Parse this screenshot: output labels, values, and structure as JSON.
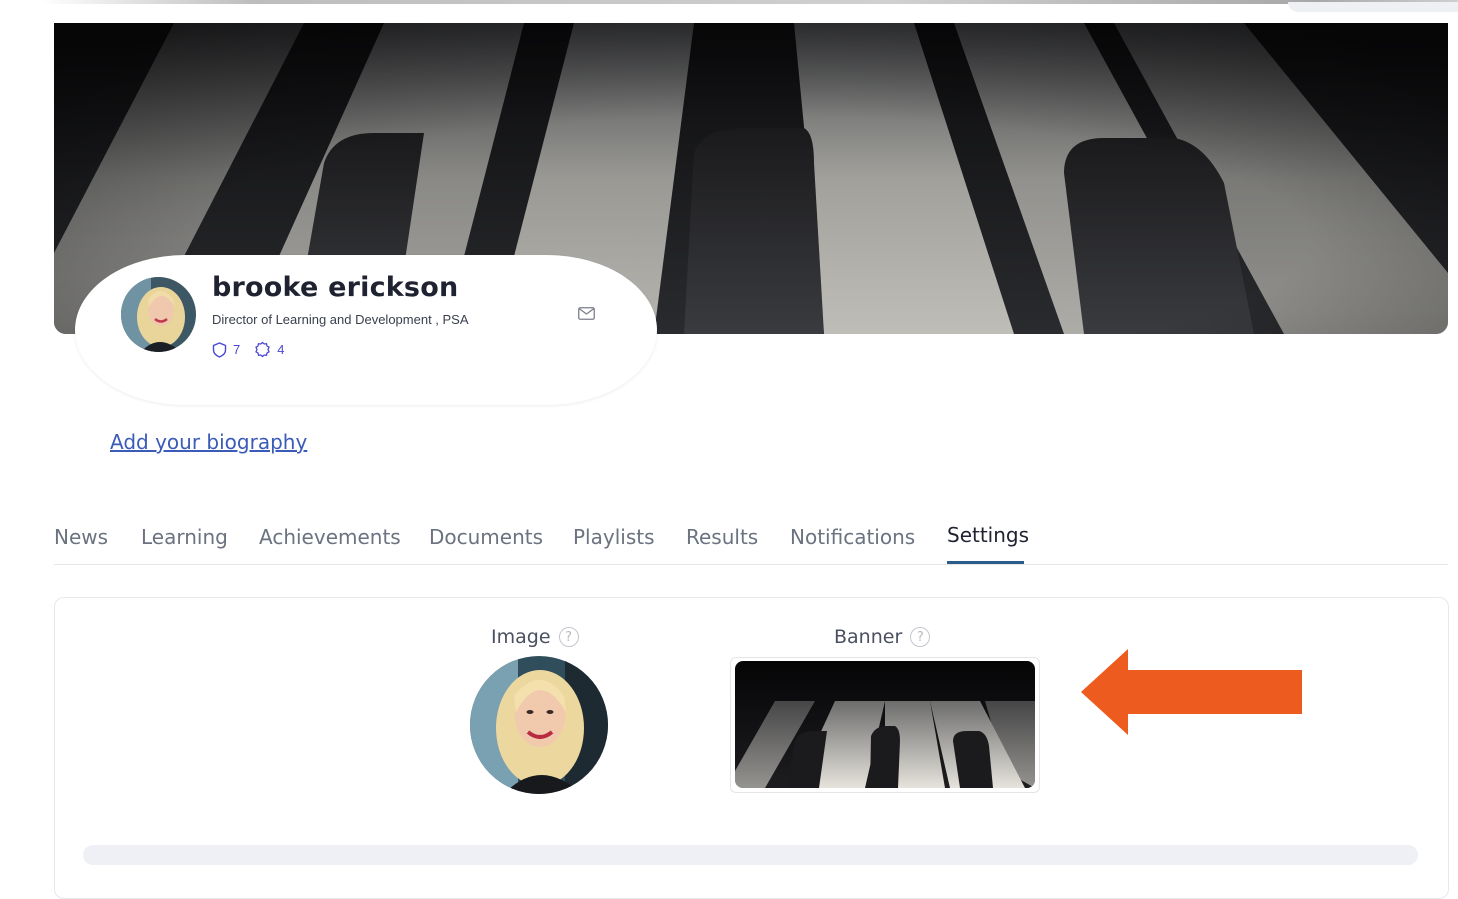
{
  "profile": {
    "name": "brooke erickson",
    "title": "Director of Learning and Development , PSA",
    "stats": {
      "badges": "7",
      "skills": "4"
    },
    "avatar_alt": "profile-photo",
    "bio_link": "Add your biography"
  },
  "tabs": [
    {
      "label": "News"
    },
    {
      "label": "Learning"
    },
    {
      "label": "Achievements"
    },
    {
      "label": "Documents"
    },
    {
      "label": "Playlists"
    },
    {
      "label": "Results"
    },
    {
      "label": "Notifications"
    },
    {
      "label": "Settings",
      "active": true
    }
  ],
  "settings": {
    "image_label": "Image",
    "banner_label": "Banner",
    "help_glyph": "?"
  },
  "annotation": {
    "arrow_color": "#ed5b1f",
    "direction": "left"
  },
  "colors": {
    "accent": "#2b5c8a",
    "link": "#3b5bb8",
    "stats": "#4b47d6"
  }
}
